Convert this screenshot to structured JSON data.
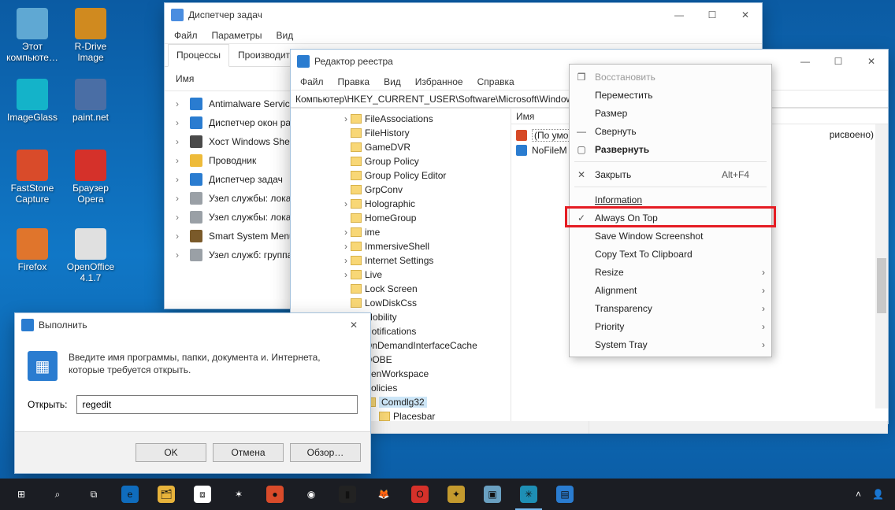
{
  "desktop": {
    "icons": [
      {
        "label": "Этот компьюте…",
        "color": "#5fa8d3"
      },
      {
        "label": "R-Drive Image",
        "color": "#d08a1f"
      },
      {
        "label": "ImageGlass",
        "color": "#14b3c9"
      },
      {
        "label": "paint.net",
        "color": "#4a6ea5"
      },
      {
        "label": "FastStone Capture",
        "color": "#d94b2a"
      },
      {
        "label": "Браузер Opera",
        "color": "#d5312a"
      },
      {
        "label": "Firefox",
        "color": "#e0752c"
      },
      {
        "label": "OpenOffice 4.1.7",
        "color": "#e0e0e0"
      }
    ]
  },
  "taskmgr": {
    "title": "Диспетчер задач",
    "menu": [
      "Файл",
      "Параметры",
      "Вид"
    ],
    "tabs": [
      "Процессы",
      "Производител"
    ],
    "col_name": "Имя",
    "processes": [
      {
        "name": "Antimalware Service",
        "icon": "#2a7cd0"
      },
      {
        "name": "Диспетчер окон ра",
        "icon": "#2a7cd0"
      },
      {
        "name": "Хост Windows Shell",
        "icon": "#4a4a4a"
      },
      {
        "name": "Проводник",
        "icon": "#eebb3a"
      },
      {
        "name": "Диспетчер задач",
        "icon": "#2a7cd0"
      },
      {
        "name": "Узел службы: лока",
        "icon": "#9aa0a6"
      },
      {
        "name": "Узел службы: лока",
        "icon": "#9aa0a6"
      },
      {
        "name": "Smart System Menu",
        "icon": "#7a5a2a"
      },
      {
        "name": "Узел служб: группа",
        "icon": "#9aa0a6"
      }
    ]
  },
  "regedit": {
    "title": "Редактор реестра",
    "menu": [
      "Файл",
      "Правка",
      "Вид",
      "Избранное",
      "Справка"
    ],
    "address": "Компьютер\\HKEY_CURRENT_USER\\Software\\Microsoft\\Windows\\",
    "tree": [
      {
        "label": "FileAssociations",
        "exp": ">"
      },
      {
        "label": "FileHistory",
        "exp": ""
      },
      {
        "label": "GameDVR",
        "exp": ""
      },
      {
        "label": "Group Policy",
        "exp": ""
      },
      {
        "label": "Group Policy Editor",
        "exp": ""
      },
      {
        "label": "GrpConv",
        "exp": ""
      },
      {
        "label": "Holographic",
        "exp": ">"
      },
      {
        "label": "HomeGroup",
        "exp": ""
      },
      {
        "label": "ime",
        "exp": ">"
      },
      {
        "label": "ImmersiveShell",
        "exp": ">"
      },
      {
        "label": "Internet Settings",
        "exp": ">"
      },
      {
        "label": "Live",
        "exp": ">"
      },
      {
        "label": "Lock Screen",
        "exp": ""
      },
      {
        "label": "LowDiskCss",
        "exp": ""
      },
      {
        "label": "Mobility",
        "exp": ">"
      },
      {
        "label": "Notifications",
        "exp": ">"
      },
      {
        "label": "OnDemandInterfaceCache",
        "exp": ""
      },
      {
        "label": "OOBE",
        "exp": ""
      },
      {
        "label": "PenWorkspace",
        "exp": ">"
      },
      {
        "label": "Policies",
        "exp": "v"
      },
      {
        "label": "Comdlg32",
        "exp": "v",
        "indent": 1,
        "sel": true
      },
      {
        "label": "Placesbar",
        "exp": "",
        "indent": 2
      }
    ],
    "val_col": "Имя",
    "values": [
      {
        "name": "(По умо",
        "type": "ab",
        "color": "#d64926"
      },
      {
        "name": "NoFileM",
        "type": "bin",
        "color": "#2a7cd0"
      }
    ],
    "val_note": "рисвоено)"
  },
  "ctx": {
    "items": [
      {
        "label": "Восстановить",
        "icon": "❐",
        "disabled": true
      },
      {
        "label": "Переместить"
      },
      {
        "label": "Размер"
      },
      {
        "label": "Свернуть",
        "icon": "—"
      },
      {
        "label": "Развернуть",
        "icon": "▢",
        "bold": true
      },
      {
        "sep": true
      },
      {
        "label": "Закрыть",
        "icon": "✕",
        "shortcut": "Alt+F4"
      },
      {
        "sep": true
      },
      {
        "label": "Information",
        "underline": true
      },
      {
        "label": "Always On Top",
        "icon": "✓",
        "hilite": true
      },
      {
        "label": "Save Window Screenshot"
      },
      {
        "label": "Copy Text To Clipboard"
      },
      {
        "label": "Resize",
        "sub": true
      },
      {
        "label": "Alignment",
        "sub": true
      },
      {
        "label": "Transparency",
        "sub": true
      },
      {
        "label": "Priority",
        "sub": true
      },
      {
        "label": "System Tray",
        "sub": true
      }
    ]
  },
  "run": {
    "title": "Выполнить",
    "desc": "Введите имя программы, папки, документа и.\nИнтернета, которые требуется открыть.",
    "open_label": "Открыть:",
    "value": "regedit",
    "buttons": [
      "OK",
      "Отмена",
      "Обзор…"
    ]
  },
  "taskbar": {
    "apps": [
      {
        "name": "start",
        "glyph": "⊞",
        "bg": ""
      },
      {
        "name": "search",
        "glyph": "⌕",
        "bg": ""
      },
      {
        "name": "taskview",
        "glyph": "⧉",
        "bg": ""
      },
      {
        "name": "edge",
        "glyph": "e",
        "bg": "#0f6cbd"
      },
      {
        "name": "explorer",
        "glyph": "🗂",
        "bg": "#e8b33b"
      },
      {
        "name": "store",
        "glyph": "⧈",
        "bg": "#ffffff"
      },
      {
        "name": "settings",
        "glyph": "✶",
        "bg": ""
      },
      {
        "name": "faststone",
        "glyph": "●",
        "bg": "#d94b2a"
      },
      {
        "name": "chrome",
        "glyph": "◉",
        "bg": ""
      },
      {
        "name": "cmd",
        "glyph": "▮",
        "bg": "#222"
      },
      {
        "name": "firefox",
        "glyph": "🦊",
        "bg": ""
      },
      {
        "name": "opera",
        "glyph": "O",
        "bg": "#d5312a"
      },
      {
        "name": "app1",
        "glyph": "✦",
        "bg": "#c49a2e"
      },
      {
        "name": "photos",
        "glyph": "▣",
        "bg": "#6aa0c1"
      },
      {
        "name": "smartmenu",
        "glyph": "✳",
        "bg": "#1e8fb5",
        "active": true
      },
      {
        "name": "regedit-tb",
        "glyph": "▤",
        "bg": "#2a7cd0"
      }
    ],
    "tray_user": "👤"
  }
}
